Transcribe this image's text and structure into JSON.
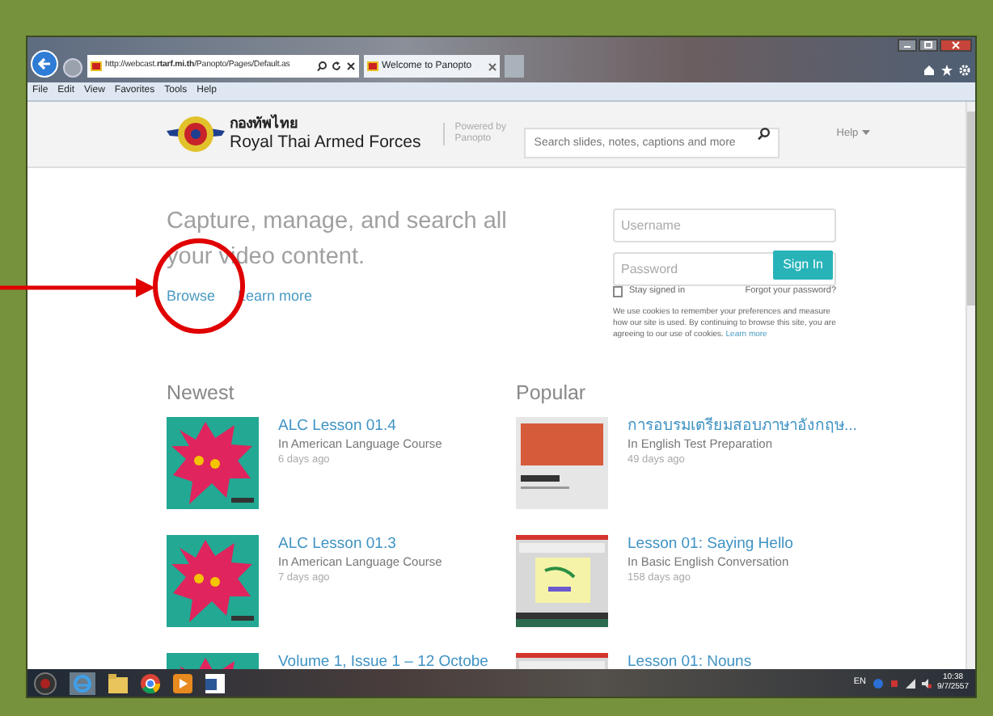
{
  "browser": {
    "address": "http://webcast.**rtarf.mi.th**/Panopto/Pages/Default.as",
    "tab": "Welcome to Panopto",
    "menu": [
      "File",
      "Edit",
      "View",
      "Favorites",
      "Tools",
      "Help"
    ]
  },
  "header": {
    "logo_thai": "กองทัพไทย",
    "logo_english": "Royal Thai Armed Forces",
    "powered_by": "Powered by Panopto",
    "search": {
      "placeholder": "Search slides, notes, captions and more"
    },
    "help": "Help"
  },
  "hero": {
    "tagline": "Capture, manage, and search all your video content.",
    "links": [
      "Browse",
      "Learn more"
    ]
  },
  "login": {
    "username": {
      "placeholder": "Username"
    },
    "password": {
      "placeholder": "Password"
    },
    "button": "Sign In",
    "stay_signed_in": {
      "label": "Stay signed in",
      "checked": false
    },
    "forgot": "Forgot your password?",
    "notice": "We use cookies to remember your preferences and measure how our site is used. By continuing to browse this site, you are agreeing to our use of cookies.",
    "notice_link": "Learn more"
  },
  "sections": [
    {
      "title": "Newest",
      "items": [
        {
          "title": "ALC Lesson 01.4",
          "folder": "In American Language Course",
          "age": "6 days ago"
        },
        {
          "title": "ALC Lesson 01.3",
          "folder": "In American Language Course",
          "age": "7 days ago"
        },
        {
          "title": "Volume 1, Issue 1 – 12 Octobe"
        }
      ]
    },
    {
      "title": "Popular",
      "items": [
        {
          "title": "การอบรมเตรียมสอบภาษาอังกฤษ...",
          "folder": "In English Test Preparation",
          "age": "49 days ago"
        },
        {
          "title": "Lesson 01: Saying Hello",
          "folder": "In Basic English Conversation",
          "age": "158 days ago"
        },
        {
          "title": "Lesson 01: Nouns"
        }
      ]
    }
  ],
  "taskbar": {
    "language": "EN",
    "time": "10:38",
    "date": "9/7/2557"
  }
}
